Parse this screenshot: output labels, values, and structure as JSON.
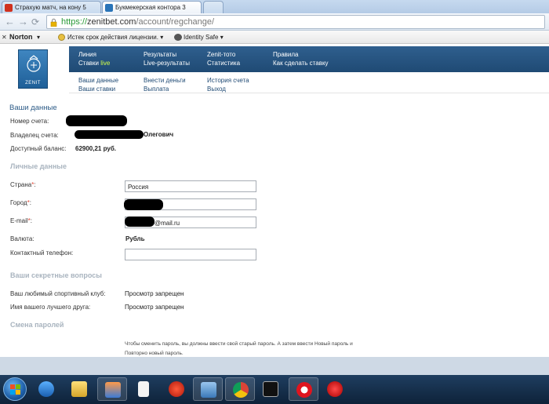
{
  "tabs": [
    {
      "title": "Страхую матч, на кону 5"
    },
    {
      "title": "Букмекерская контора 3"
    }
  ],
  "address_bar": {
    "scheme": "https://",
    "host": "zenitbet.com",
    "path": "/account/regchange/"
  },
  "norton_toolbar": {
    "brand": "Norton",
    "license": "Истек срок действия лицензии.",
    "identity": "Identity Safe"
  },
  "site": {
    "logo_text": "ZENIT",
    "menu": [
      {
        "label": "Линия"
      },
      {
        "label": "Ставки",
        "tag": "live"
      },
      {
        "label": "Результаты"
      },
      {
        "label": "Live-результаты"
      },
      {
        "label": "Zenit-тото"
      },
      {
        "label": "Статистика"
      },
      {
        "label": "Правила"
      },
      {
        "label": "Как сделать ставку"
      }
    ],
    "submenu": [
      {
        "label": "Ваши данные"
      },
      {
        "label": "Ваши ставки"
      },
      {
        "label": "Внести деньги"
      },
      {
        "label": "Выплата"
      },
      {
        "label": "История счета"
      },
      {
        "label": "Выход"
      }
    ]
  },
  "account": {
    "title": "Ваши данные",
    "account_number_label": "Номер счета:",
    "owner_label": "Владелец счета:",
    "owner_visible": "Олегович",
    "balance_label": "Доступный баланс:",
    "balance_value": "62900,21 руб."
  },
  "personal": {
    "title": "Личные данные",
    "country_label": "Страна",
    "country_value": "Россия",
    "city_label": "Город",
    "email_label": "E-mail",
    "email_visible": "@mail.ru",
    "currency_label": "Валюта:",
    "currency_value": "Рубль",
    "phone_label": "Контактный телефон:"
  },
  "secret": {
    "title": "Ваши секретные вопросы",
    "q1_label": "Ваш любимый спортивный клуб:",
    "q1_value": "Просмотр запрещен",
    "q2_label": "Имя вашего лучшего друга:",
    "q2_value": "Просмотр запрещен"
  },
  "password": {
    "title": "Смена паролей",
    "note_line1": "Чтобы сменить пароль, вы должны ввести свой старый пароль. А затем ввести Новый пароль и",
    "note_line2": "Повторно новый пароль."
  },
  "colors": {
    "menu_bg": "#1f4a74",
    "live_accent": "#d4ff4a",
    "section_title": "#2d5b87",
    "taskbar": "#0e2239"
  },
  "taskbar_icons": [
    "start-orb",
    "media-player-icon",
    "file-explorer-icon",
    "images-icon",
    "document-icon",
    "pokerstars-icon",
    "hp-icon",
    "chrome-icon",
    "full-tilt-icon",
    "opera-icon",
    "app-13-icon"
  ]
}
